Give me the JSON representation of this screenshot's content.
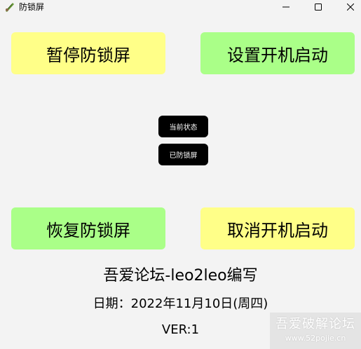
{
  "window": {
    "title": "防锁屏",
    "icon": "app-feather-icon",
    "controls": [
      "minimize-icon",
      "maximize-icon",
      "close-icon"
    ]
  },
  "buttons": {
    "pause": "暂停防锁屏",
    "set_startup": "设置开机启动",
    "resume": "恢复防锁屏",
    "cancel_startup": "取消开机启动"
  },
  "status": {
    "label": "当前状态",
    "value": "已防锁屏"
  },
  "footer": {
    "author": "吾爱论坛-leo2leo编写",
    "date": "日期：2022年11月10日(周四)",
    "version": "VER:1"
  },
  "watermark": {
    "text": "吾爱破解论坛",
    "url": "www.52pojie.cn"
  },
  "colors": {
    "yellow_button": "#ffff88",
    "green_button": "#aaff88",
    "status_button": "#000000",
    "background": "#f3f3f3"
  }
}
